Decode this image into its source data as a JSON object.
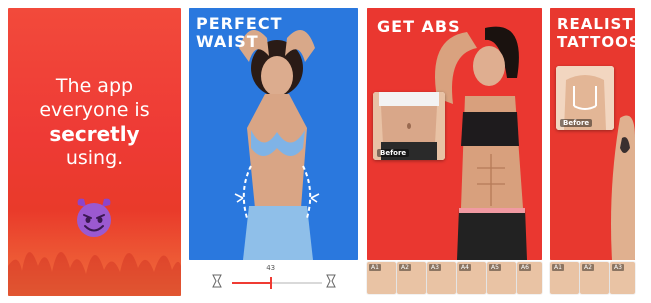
{
  "intro": {
    "line1": "The app",
    "line2": "everyone is",
    "line3": "secretly",
    "line4": "using.",
    "emoji_icon": "smiling-devil-icon"
  },
  "waist": {
    "title_line1": "PERFECT",
    "title_line2": "WAIST",
    "slider_value": "43",
    "slider_fraction": 0.43
  },
  "abs": {
    "title": "GET ABS",
    "before_label": "Before",
    "thumbs": [
      "A1",
      "A2",
      "A3",
      "A4",
      "A5",
      "A6"
    ]
  },
  "tattoos": {
    "title_line1": "REALISTI",
    "title_line2": "TATTOOS",
    "before_label": "Before",
    "thumbs": [
      "A1",
      "A2",
      "A3"
    ]
  },
  "colors": {
    "brand_red": "#ef3b33",
    "waist_blue": "#1e6fd6"
  }
}
